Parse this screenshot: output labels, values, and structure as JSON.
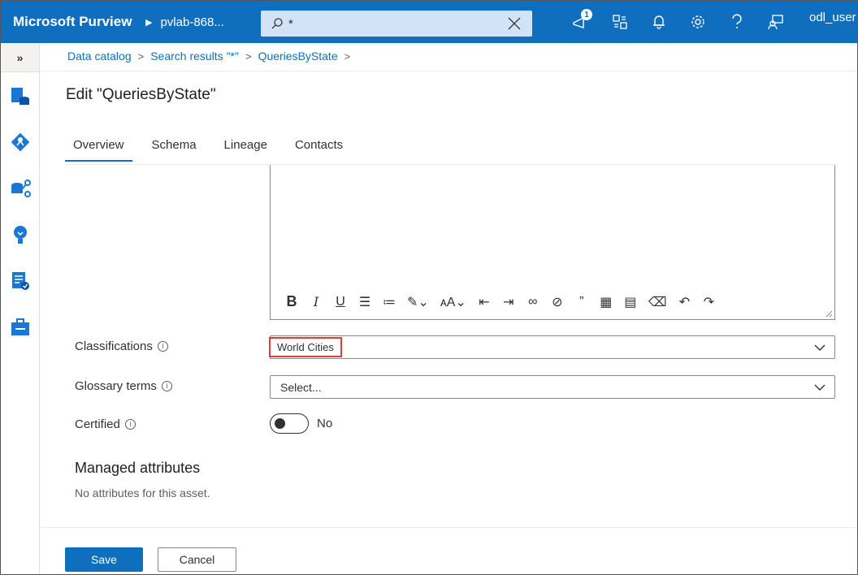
{
  "header": {
    "brand": "Microsoft Purview",
    "tenant": "pvlab-868...",
    "search_value": "*",
    "notification_count": "1",
    "user": "odl_user"
  },
  "nav": {
    "expand_label": "»",
    "items": [
      "data-catalog-icon",
      "data-map-icon",
      "data-sources-icon",
      "insights-icon",
      "policy-icon",
      "management-icon"
    ]
  },
  "breadcrumb": {
    "items": [
      "Data catalog",
      "Search results \"*\"",
      "QueriesByState"
    ]
  },
  "page": {
    "title": "Edit \"QueriesByState\""
  },
  "tabs": [
    "Overview",
    "Schema",
    "Lineage",
    "Contacts"
  ],
  "active_tab": "Overview",
  "form": {
    "classifications_label": "Classifications",
    "classification_value": "World Cities",
    "glossary_label": "Glossary terms",
    "glossary_placeholder": "Select...",
    "certified_label": "Certified",
    "certified_value": "No"
  },
  "managed_attributes": {
    "title": "Managed attributes",
    "empty_text": "No attributes for this asset."
  },
  "actions": {
    "save": "Save",
    "cancel": "Cancel"
  },
  "colors": {
    "header": "#106ebe",
    "highlight": "#e03c3c"
  }
}
